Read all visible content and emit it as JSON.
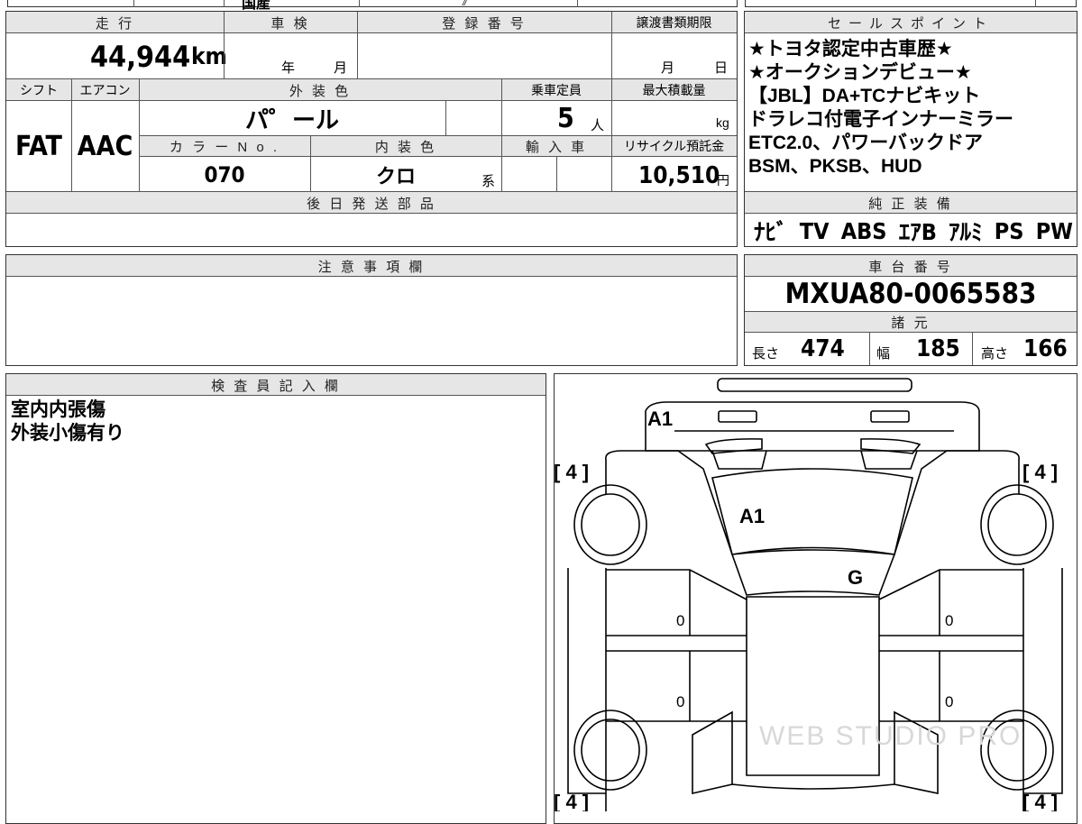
{
  "top_strip": {
    "fragment_a": "国産",
    "fragment_b": "》"
  },
  "left_table": {
    "mileage_label": "走 行",
    "mileage_value": "44,944",
    "mileage_unit": "km",
    "inspection_label": "車 検",
    "inspection_year": "年",
    "inspection_month": "月",
    "registration_label": "登 録 番 号",
    "transfer_deadline_label": "譲渡書類期限",
    "transfer_month": "月",
    "transfer_day": "日",
    "shift_label": "シフト",
    "shift_value": "FAT",
    "ac_label": "エアコン",
    "ac_value": "AAC",
    "exterior_color_label": "外 装 色",
    "exterior_color_value": "パ゜ール",
    "capacity_label": "乗車定員",
    "capacity_value": "5",
    "capacity_unit": "人",
    "max_load_label": "最大積載量",
    "max_load_unit": "kg",
    "color_no_label": "カ ラ ー N o .",
    "color_no_value": "070",
    "interior_color_label": "内 装 色",
    "interior_color_value": "クロ",
    "interior_color_suffix": "系",
    "import_label": "輸 入 車",
    "recycle_label": "リサイクル預託金",
    "recycle_value": "10,510",
    "recycle_unit": "円",
    "parts_label": "後 日 発 送 部 品"
  },
  "sales_points": {
    "header": "セールスポイント",
    "lines": [
      "★トヨタ認定中古車歴★",
      "★オークションデビュー★",
      "【JBL】DA+TCナビキット",
      "ドラレコ付電子インナーミラー",
      "ETC2.0、パワーバックドア",
      "BSM、PKSB、HUD"
    ]
  },
  "genuine_equipment": {
    "header": "純 正 装 備",
    "items": [
      "ﾅﾋﾞ",
      "TV",
      "ABS",
      "ｴｱB",
      "ｱﾙﾐ",
      "PS",
      "PW"
    ]
  },
  "notes": {
    "header": "注 意 事 項 欄"
  },
  "chassis": {
    "header": "車 台 番 号",
    "value": "MXUA80-0065583"
  },
  "specs": {
    "header": "諸 元",
    "length_label": "長さ",
    "length_value": "474",
    "width_label": "幅",
    "width_value": "185",
    "height_label": "高さ",
    "height_value": "166"
  },
  "inspector": {
    "header": "検 査 員 記 入 欄",
    "lines": [
      "室内内張傷",
      "外装小傷有り"
    ]
  },
  "diagram": {
    "tire_marks": [
      "[ 4 ]",
      "[ 4 ]",
      "[ 4 ]",
      "[ 4 ]"
    ],
    "marks": [
      "A1",
      "A1",
      "G",
      "0",
      "0",
      "0",
      "0"
    ],
    "watermark": "WEB STUDIO PRO"
  }
}
